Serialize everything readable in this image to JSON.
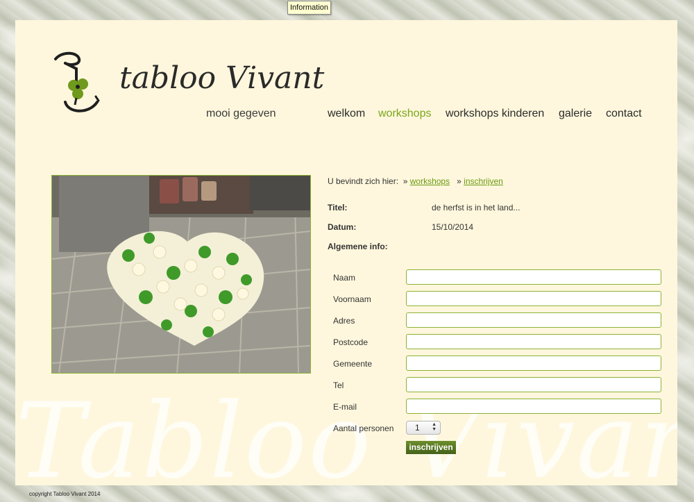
{
  "tooltip": "Information",
  "logo": {
    "name": "tabloo Vivant",
    "tagline": "mooi gegeven",
    "watermark": "Tabloo Vivant"
  },
  "nav": {
    "items": [
      {
        "label": "welkom",
        "active": false
      },
      {
        "label": "workshops",
        "active": true
      },
      {
        "label": "workshops kinderen",
        "active": false
      },
      {
        "label": "galerie",
        "active": false
      },
      {
        "label": "contact",
        "active": false
      }
    ]
  },
  "breadcrumb": {
    "prefix": "U bevindt zich hier:",
    "sep": "»",
    "items": [
      "workshops",
      "inschrijven"
    ]
  },
  "info": {
    "titel_label": "Titel:",
    "titel_value": "de herfst is in het land...",
    "datum_label": "Datum:",
    "datum_value": "15/10/2014",
    "algemene_label": "Algemene info:"
  },
  "form": {
    "fields": [
      {
        "label": "Naam",
        "value": ""
      },
      {
        "label": "Voornaam",
        "value": ""
      },
      {
        "label": "Adres",
        "value": ""
      },
      {
        "label": "Postcode",
        "value": ""
      },
      {
        "label": "Gemeente",
        "value": ""
      },
      {
        "label": "Tel",
        "value": ""
      },
      {
        "label": "E-mail",
        "value": ""
      }
    ],
    "persons_label": "Aantal personen",
    "persons_value": "1",
    "submit_label": "inschrijven"
  },
  "footer": {
    "copyright": "copyright Tabloo Vivant 2014"
  },
  "colors": {
    "accent": "#7aa51a",
    "panel": "#fef7dd",
    "button": "#4f6e1f"
  }
}
